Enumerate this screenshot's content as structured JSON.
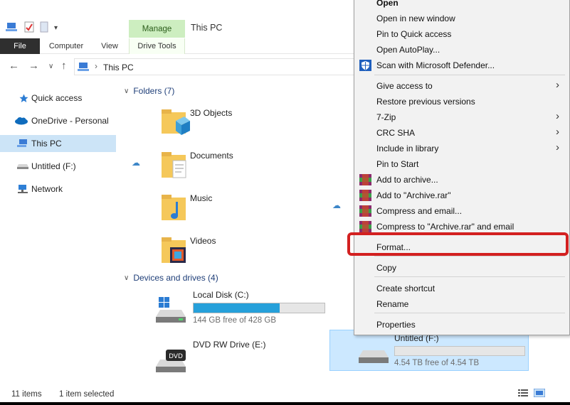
{
  "ribbon": {
    "manage_tab": "Manage",
    "window_title": "This PC",
    "tabs": [
      "File",
      "Computer",
      "View",
      "Drive Tools"
    ]
  },
  "address": {
    "path": "This PC"
  },
  "sidebar": {
    "items": [
      {
        "label": "Quick access",
        "icon": "star-icon"
      },
      {
        "label": "OneDrive - Personal",
        "icon": "cloud-icon"
      },
      {
        "label": "This PC",
        "icon": "computer-icon"
      },
      {
        "label": "Untitled (F:)",
        "icon": "drive-icon"
      },
      {
        "label": "Network",
        "icon": "network-icon"
      }
    ]
  },
  "folders": {
    "header": "Folders (7)",
    "items": [
      "3D Objects",
      "Documents",
      "Music",
      "Videos"
    ]
  },
  "devices": {
    "header": "Devices and drives (4)",
    "drives": [
      {
        "name": "Local Disk (C:)",
        "free": "144 GB free of 428 GB",
        "used_fraction": 0.66
      },
      {
        "name": "DVD RW Drive (E:)"
      },
      {
        "name": "Untitled (F:)",
        "free": "4.54 TB free of 4.54 TB",
        "used_fraction": 0.0
      }
    ]
  },
  "context_menu": {
    "items": [
      {
        "label": "Open",
        "bold": true
      },
      {
        "label": "Open in new window"
      },
      {
        "label": "Pin to Quick access"
      },
      {
        "label": "Open AutoPlay..."
      },
      {
        "label": "Scan with Microsoft Defender...",
        "icon": "defender-icon"
      },
      {
        "label": "Give access to",
        "submenu": true
      },
      {
        "label": "Restore previous versions"
      },
      {
        "label": "7-Zip",
        "submenu": true
      },
      {
        "label": "CRC SHA",
        "submenu": true
      },
      {
        "label": "Include in library",
        "submenu": true
      },
      {
        "label": "Pin to Start"
      },
      {
        "label": "Add to archive...",
        "icon": "winrar-icon"
      },
      {
        "label": "Add to \"Archive.rar\"",
        "icon": "winrar-icon"
      },
      {
        "label": "Compress and email...",
        "icon": "winrar-icon"
      },
      {
        "label": "Compress to \"Archive.rar\" and email",
        "icon": "winrar-icon"
      },
      {
        "label": "Format..."
      },
      {
        "label": "Copy"
      },
      {
        "label": "Create shortcut"
      },
      {
        "label": "Rename"
      },
      {
        "label": "Properties"
      }
    ]
  },
  "status": {
    "count": "11 items",
    "selected": "1 item selected"
  },
  "colors": {
    "accent": "#26a0da",
    "manage": "#cdeec0",
    "highlight": "#d32020",
    "selection": "#cce8ff"
  }
}
